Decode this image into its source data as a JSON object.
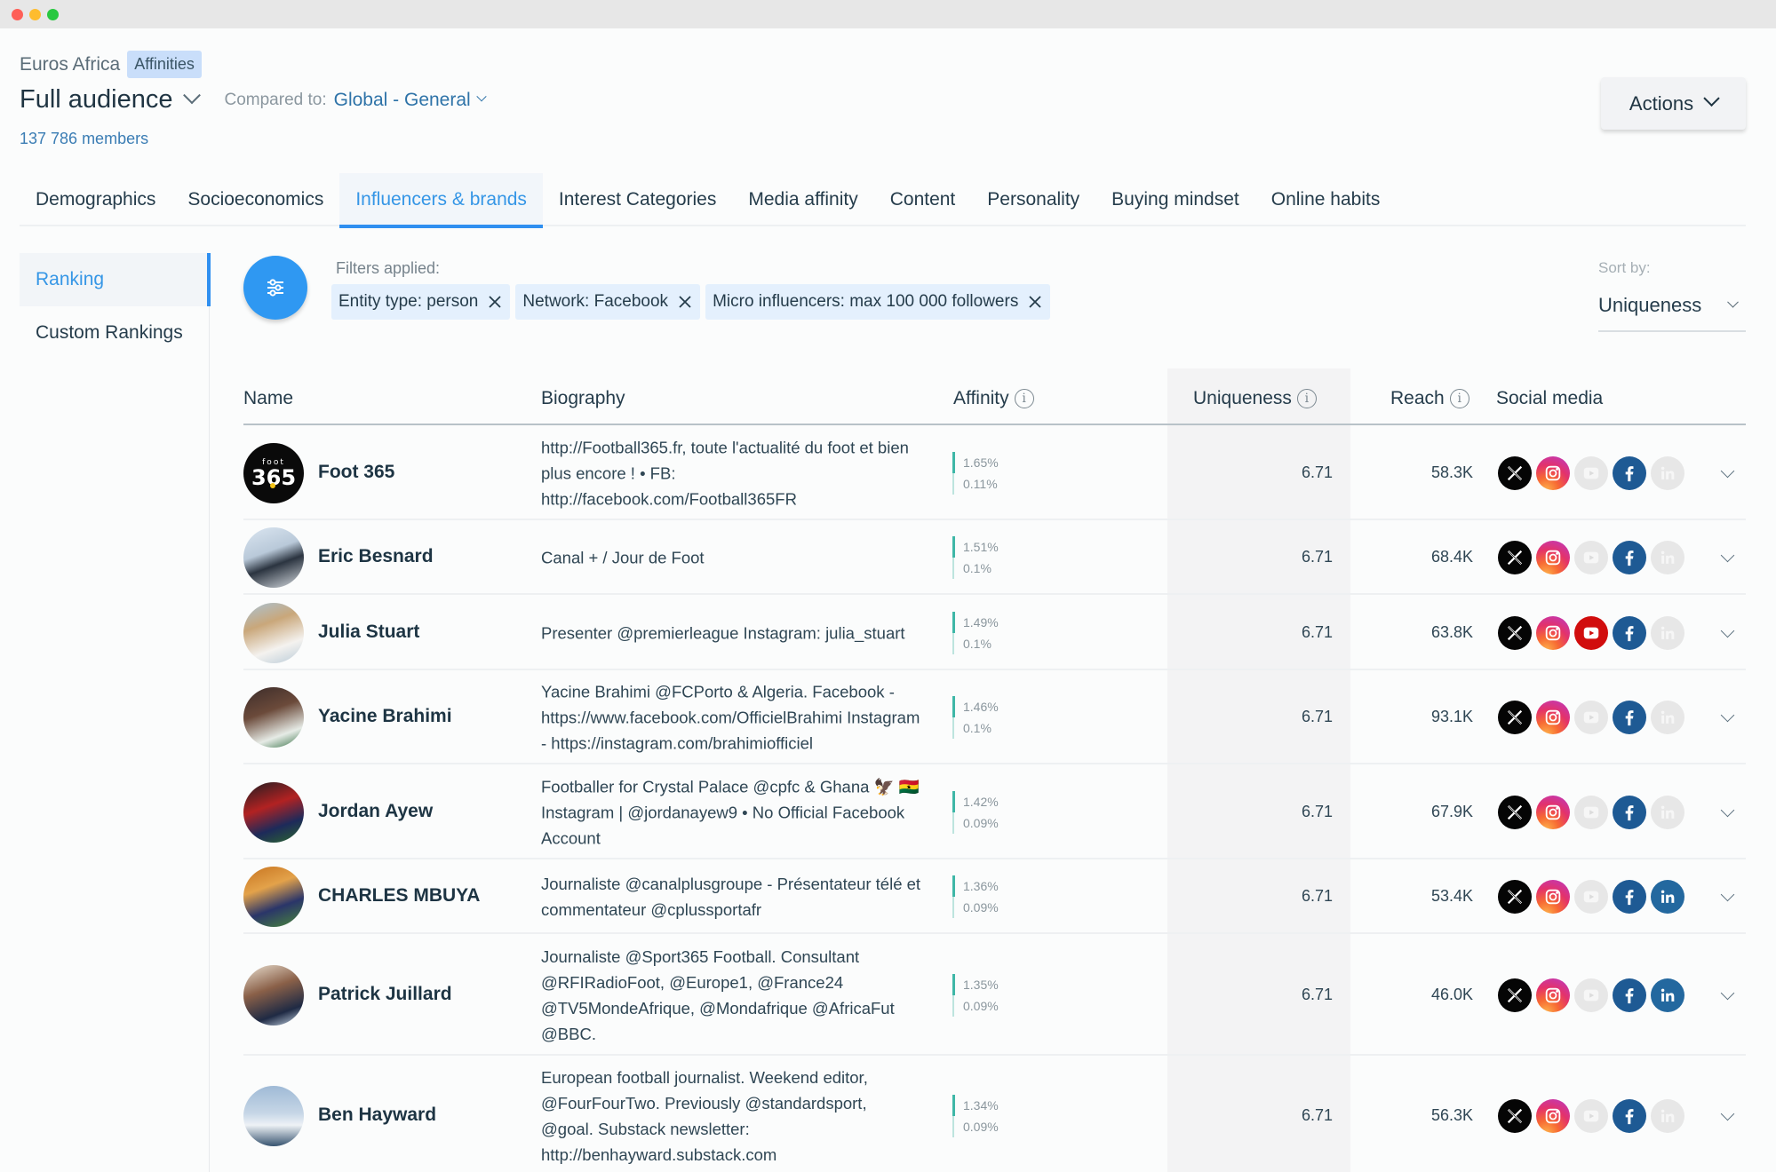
{
  "window": {
    "controls": [
      "close",
      "minimize",
      "maximize"
    ]
  },
  "header": {
    "project": "Euros Africa",
    "tag": "Affinities",
    "audience": "Full audience",
    "compared_label": "Compared to:",
    "compared_value": "Global - General",
    "members": "137 786 members",
    "actions_label": "Actions"
  },
  "tabs": [
    {
      "label": "Demographics",
      "active": false
    },
    {
      "label": "Socioeconomics",
      "active": false
    },
    {
      "label": "Influencers & brands",
      "active": true
    },
    {
      "label": "Interest Categories",
      "active": false
    },
    {
      "label": "Media affinity",
      "active": false
    },
    {
      "label": "Content",
      "active": false
    },
    {
      "label": "Personality",
      "active": false
    },
    {
      "label": "Buying mindset",
      "active": false
    },
    {
      "label": "Online habits",
      "active": false
    }
  ],
  "sidebar": {
    "items": [
      {
        "label": "Ranking",
        "active": true
      },
      {
        "label": "Custom Rankings",
        "active": false
      }
    ]
  },
  "filters": {
    "label": "Filters applied:",
    "chips": [
      "Entity type: person",
      "Network: Facebook",
      "Micro influencers: max 100 000 followers"
    ]
  },
  "sort": {
    "label": "Sort by:",
    "value": "Uniqueness"
  },
  "table": {
    "columns": {
      "name": "Name",
      "biography": "Biography",
      "affinity": "Affinity",
      "uniqueness": "Uniqueness",
      "reach": "Reach",
      "social": "Social media"
    },
    "rows": [
      {
        "name": "Foot 365",
        "avatar": "foot365-logo",
        "bio": "http://Football365.fr, toute l'actualité du foot et bien plus encore ! • FB: http://facebook.com/Football365FR",
        "affinity_top": "1.65%",
        "affinity_bottom": "0.11%",
        "uniqueness": "6.71",
        "reach": "58.3K",
        "social": {
          "x": true,
          "instagram": true,
          "youtube": false,
          "facebook": true,
          "linkedin": false
        }
      },
      {
        "name": "Eric Besnard",
        "avatar": "photo",
        "bio": "Canal + / Jour de Foot",
        "affinity_top": "1.51%",
        "affinity_bottom": "0.1%",
        "uniqueness": "6.71",
        "reach": "68.4K",
        "social": {
          "x": true,
          "instagram": true,
          "youtube": false,
          "facebook": true,
          "linkedin": false
        }
      },
      {
        "name": "Julia Stuart",
        "avatar": "photo",
        "bio": "Presenter @premierleague Instagram: julia_stuart",
        "affinity_top": "1.49%",
        "affinity_bottom": "0.1%",
        "uniqueness": "6.71",
        "reach": "63.8K",
        "social": {
          "x": true,
          "instagram": true,
          "youtube": true,
          "facebook": true,
          "linkedin": false
        }
      },
      {
        "name": "Yacine Brahimi",
        "avatar": "photo",
        "bio": "Yacine Brahimi @FCPorto & Algeria. Facebook - https://www.facebook.com/OfficielBrahimi Instagram - https://instagram.com/brahimiofficiel",
        "affinity_top": "1.46%",
        "affinity_bottom": "0.1%",
        "uniqueness": "6.71",
        "reach": "93.1K",
        "social": {
          "x": true,
          "instagram": true,
          "youtube": false,
          "facebook": true,
          "linkedin": false
        }
      },
      {
        "name": "Jordan Ayew",
        "avatar": "photo",
        "bio": "Footballer for Crystal Palace @cpfc & Ghana 🦅 🇬🇭 Instagram | @jordanayew9 • No Official Facebook Account",
        "affinity_top": "1.42%",
        "affinity_bottom": "0.09%",
        "uniqueness": "6.71",
        "reach": "67.9K",
        "social": {
          "x": true,
          "instagram": true,
          "youtube": false,
          "facebook": true,
          "linkedin": false
        }
      },
      {
        "name": "CHARLES MBUYA",
        "avatar": "photo",
        "bio": "Journaliste @canalplusgroupe - Présentateur télé et commentateur @cplussportafr",
        "affinity_top": "1.36%",
        "affinity_bottom": "0.09%",
        "uniqueness": "6.71",
        "reach": "53.4K",
        "social": {
          "x": true,
          "instagram": true,
          "youtube": false,
          "facebook": true,
          "linkedin": true
        }
      },
      {
        "name": "Patrick Juillard",
        "avatar": "photo",
        "bio": "Journaliste @Sport365 Football. Consultant @RFIRadioFoot, @Europe1, @France24 @TV5MondeAfrique, @Mondafrique @AfricaFut @BBC.",
        "affinity_top": "1.35%",
        "affinity_bottom": "0.09%",
        "uniqueness": "6.71",
        "reach": "46.0K",
        "social": {
          "x": true,
          "instagram": true,
          "youtube": false,
          "facebook": true,
          "linkedin": true
        }
      },
      {
        "name": "Ben Hayward",
        "avatar": "photo",
        "bio": "European football journalist. Weekend editor, @FourFourTwo. Previously @standardsport, @goal. Substack newsletter: http://benhayward.substack.com",
        "affinity_top": "1.34%",
        "affinity_bottom": "0.09%",
        "uniqueness": "6.71",
        "reach": "56.3K",
        "social": {
          "x": true,
          "instagram": true,
          "youtube": false,
          "facebook": true,
          "linkedin": false
        }
      }
    ]
  },
  "colors": {
    "accent": "#2f8ff0",
    "affinity_bar": "#3eb7a7",
    "tag_bg": "#c9defa",
    "chip_bg": "#e4f0fd"
  }
}
